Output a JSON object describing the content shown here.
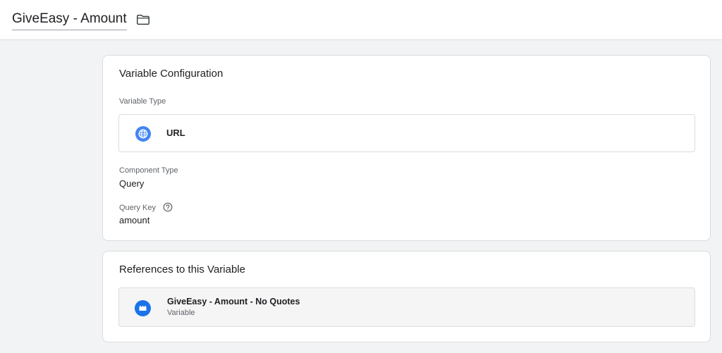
{
  "header": {
    "title": "GiveEasy - Amount",
    "folder_icon": "folder-outline-icon"
  },
  "config_card": {
    "title": "Variable Configuration",
    "variable_type_label": "Variable Type",
    "variable_type": {
      "icon": "globe-icon",
      "icon_color": "#4285f4",
      "name": "URL"
    },
    "component_type_label": "Component Type",
    "component_type_value": "Query",
    "query_key_label": "Query Key",
    "query_key_help_icon": "help-circle-icon",
    "query_key_value": "amount"
  },
  "references_card": {
    "title": "References to this Variable",
    "items": [
      {
        "icon": "variable-brick-icon",
        "icon_color": "#1a73e8",
        "name": "GiveEasy - Amount - No Quotes",
        "type": "Variable"
      }
    ]
  }
}
